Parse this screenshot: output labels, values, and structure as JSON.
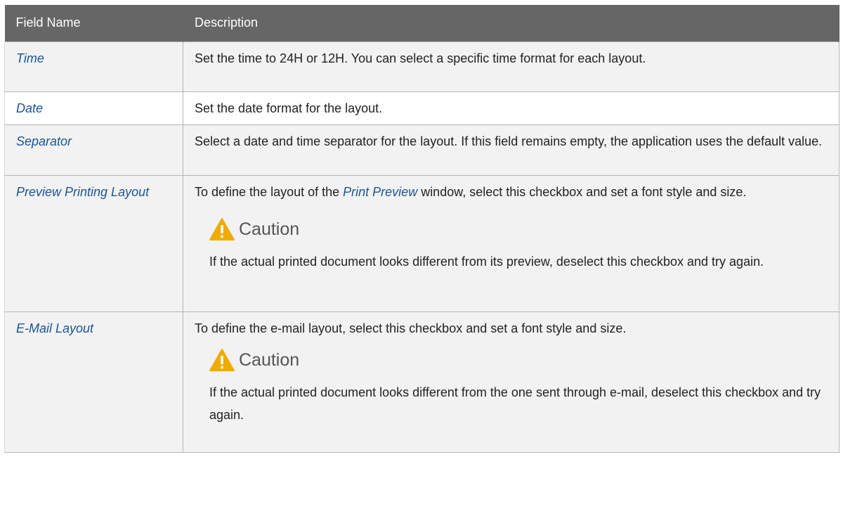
{
  "table": {
    "headers": [
      "Field Name",
      "Description"
    ],
    "rows": [
      {
        "field": "Time",
        "description": "Set the time to 24H or 12H. You can select a specific time format for each layout."
      },
      {
        "field": "Date",
        "description": "Set the date format for the layout."
      },
      {
        "field": "Separator",
        "description": "Select a date and time separator for the layout. If this field remains empty, the application uses the default value."
      },
      {
        "field": "Preview Printing Layout",
        "description_before": "To define the layout of the ",
        "description_em": "Print Preview",
        "description_after": " window, select this checkbox and set a font style and size.",
        "caution_title": "Caution",
        "caution_text": "If the actual printed document looks different from its preview, deselect this checkbox and try again."
      },
      {
        "field": "E-Mail Layout",
        "description": "To define the e-mail layout, select this checkbox and set a font style and size.",
        "caution_title": "Caution",
        "caution_text": "If the actual printed document looks different from the one sent through e-mail, deselect this checkbox and try again."
      }
    ]
  },
  "icons": {
    "caution": "warning-triangle-icon"
  },
  "colors": {
    "header_bg": "#666666",
    "field_name": "#1a5593",
    "row_alt_bg": "#f2f2f2",
    "warning": "#f0ab00"
  }
}
